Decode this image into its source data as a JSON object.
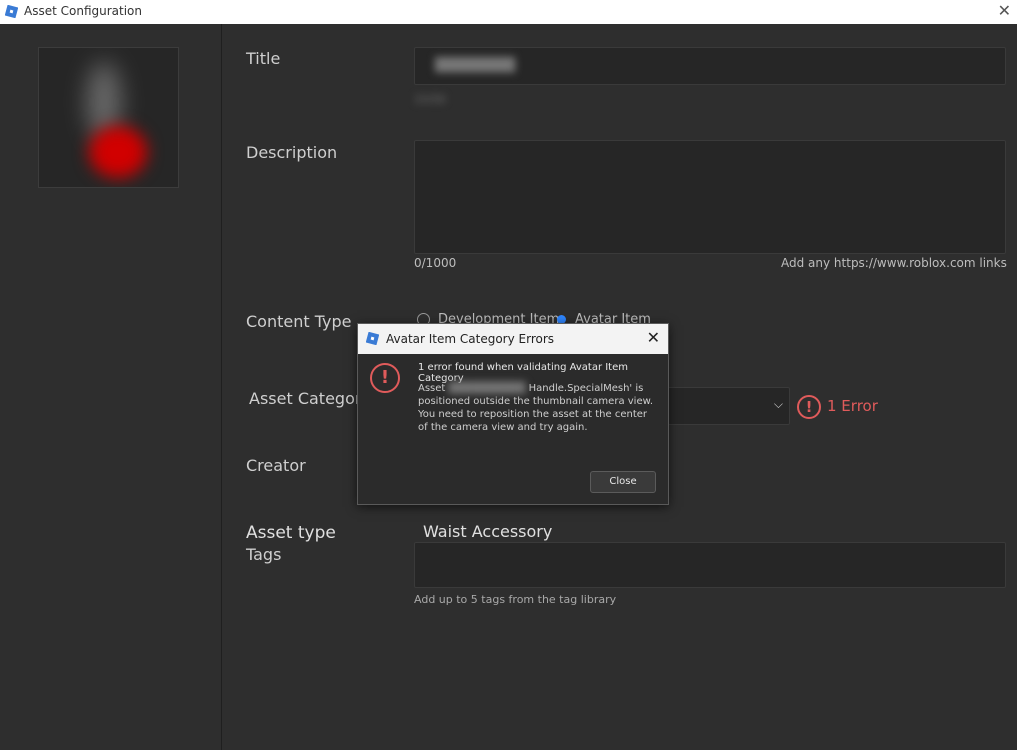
{
  "window": {
    "title": "Asset Configuration"
  },
  "fields": {
    "title_label": "Title",
    "title_counter": "15/50",
    "description_label": "Description",
    "description_counter": "0/1000",
    "description_hint": "Add any https://www.roblox.com links",
    "content_type_label": "Content Type",
    "content_type_options": [
      "Development Item",
      "Avatar Item"
    ],
    "asset_category_label": "Asset Category",
    "asset_category_error": "1 Error",
    "creator_label": "Creator",
    "asset_type_label": "Asset type",
    "asset_type_value": "Waist Accessory",
    "tags_label": "Tags",
    "tags_hint": "Add up to 5 tags from the tag library"
  },
  "dialog": {
    "title": "Avatar Item Category Errors",
    "heading": "1 error found when validating Avatar Item Category",
    "message_prefix": "Asset",
    "message_rest": "Handle.SpecialMesh' is positioned outside the thumbnail camera view. You need to reposition the asset at the center of the camera view and try again.",
    "close_button": "Close"
  },
  "icons": {
    "app": "roblox-studio-icon",
    "close": "close-icon",
    "error": "error-exclamation-icon",
    "dropdown": "chevron-down-icon"
  },
  "colors": {
    "error": "#e05b5b",
    "radio_selected": "#2f86ff",
    "background": "#2e2e2e"
  }
}
